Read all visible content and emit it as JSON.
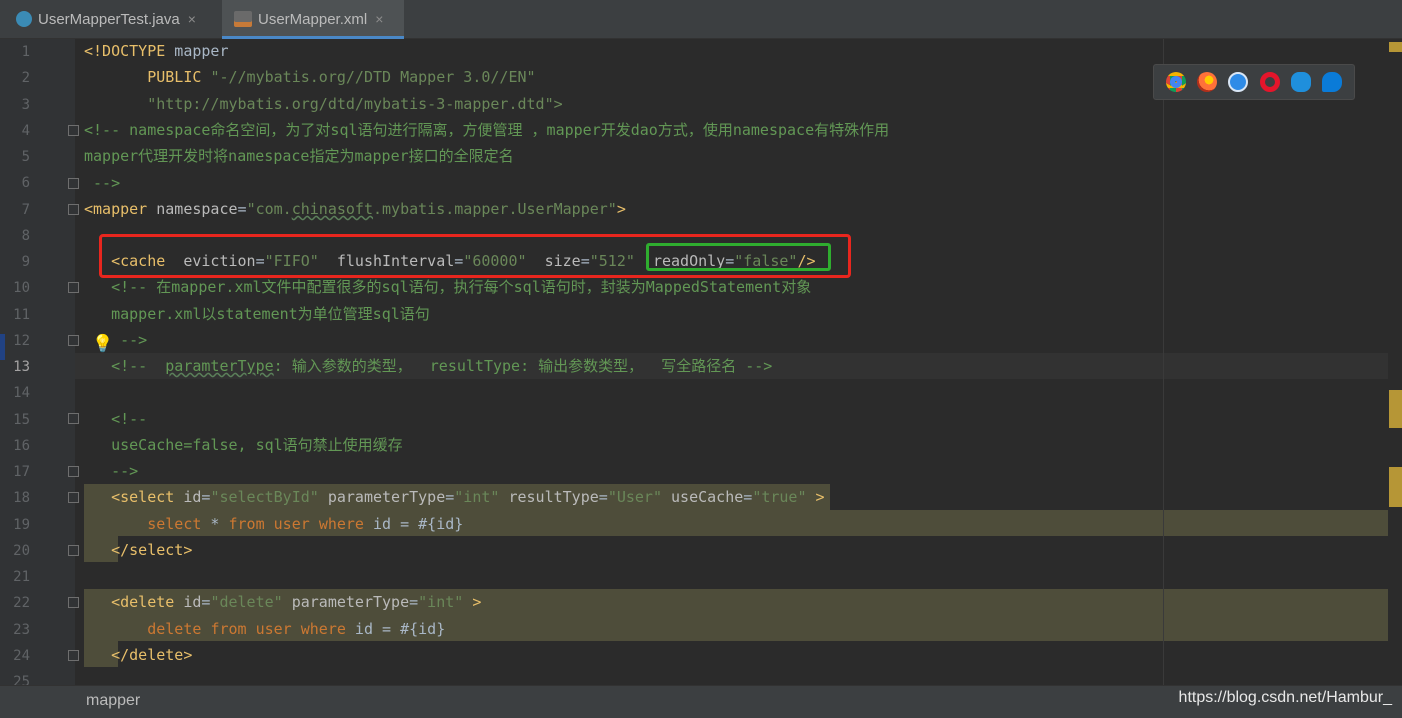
{
  "tabs": [
    {
      "label": "UserMapperTest.java",
      "icon": "java-class-icon",
      "active": false
    },
    {
      "label": "UserMapper.xml",
      "icon": "xml-file-icon",
      "active": true
    }
  ],
  "close_glyph": "×",
  "browsers": [
    "chrome",
    "firefox",
    "safari",
    "opera",
    "internet-explorer",
    "edge"
  ],
  "line_numbers": [
    "1",
    "2",
    "3",
    "4",
    "5",
    "6",
    "7",
    "8",
    "9",
    "10",
    "11",
    "12",
    "13",
    "14",
    "15",
    "16",
    "17",
    "18",
    "19",
    "20",
    "21",
    "22",
    "23",
    "24",
    "25"
  ],
  "current_line": 13,
  "code": {
    "l1_tag": "<!DOCTYPE",
    "l1_text": " mapper",
    "l2_kw": "PUBLIC",
    "l2_str": "\"-//mybatis.org//DTD Mapper 3.0//EN\"",
    "l3_str": "\"http://mybatis.org/dtd/mybatis-3-mapper.dtd\">",
    "l4": "<!-- namespace命名空间，为了对sql语句进行隔离，方便管理 ，mapper开发dao方式，使用namespace有特殊作用",
    "l5": "mapper代理开发时将namespace指定为mapper接口的全限定名",
    "l6": " -->",
    "l7_tag": "<mapper",
    "l7_attr": "namespace",
    "l7_val_a": "\"com.",
    "l7_val_b": "chinasoft",
    "l7_val_c": ".mybatis.mapper.UserMapper\"",
    "l7_close": ">",
    "l9_tag": "<cache",
    "l9_a1": "eviction",
    "l9_v1": "\"FIFO\"",
    "l9_a2": "flushInterval",
    "l9_v2": "\"60000\"",
    "l9_a3": "size",
    "l9_v3": "\"512\"",
    "l9_a4": "readOnly",
    "l9_v4": "\"false\"",
    "l9_close": "/>",
    "l10": "<!-- 在mapper.xml文件中配置很多的sql语句，执行每个sql语句时，封装为MappedStatement对象",
    "l11": "mapper.xml以statement为单位管理sql语句",
    "l12": " -->",
    "l13_a": "<!--  ",
    "l13_b": "paramterType",
    "l13_c": ": 输入参数的类型，  resultType: 输出参数类型，  写全路径名 -->",
    "l15": "<!--",
    "l16": "useCache=false, sql语句禁止使用缓存",
    "l17": "-->",
    "l18_tag": "<select",
    "l18_a1": "id",
    "l18_v1": "\"selectById\"",
    "l18_a2": "parameterType",
    "l18_v2": "\"int\"",
    "l18_a3": "resultType",
    "l18_v3": "\"User\"",
    "l18_a4": "useCache",
    "l18_v4": "\"true\"",
    "l18_close": ">",
    "l19_k1": "select",
    "l19_t1": " * ",
    "l19_k2": "from",
    "l19_t2": " ",
    "l19_k3": "user",
    "l19_t3": " ",
    "l19_k4": "where",
    "l19_t4": " id = #{id}",
    "l20": "</select>",
    "l22_tag": "<delete",
    "l22_a1": "id",
    "l22_v1": "\"delete\"",
    "l22_a2": "parameterType",
    "l22_v2": "\"int\"",
    "l22_close": ">",
    "l23_k1": "delete",
    "l23_t1": " ",
    "l23_k2": "from",
    "l23_t2": " ",
    "l23_k3": "user",
    "l23_t3": " ",
    "l23_k4": "where",
    "l23_t4": " id = #{id}",
    "l24": "</delete>"
  },
  "status": {
    "breadcrumb": "mapper",
    "watermark": "https://blog.csdn.net/Hambur_"
  },
  "annotation_colors": {
    "red_box": "#e8261e",
    "green_box": "#2fad2f"
  }
}
